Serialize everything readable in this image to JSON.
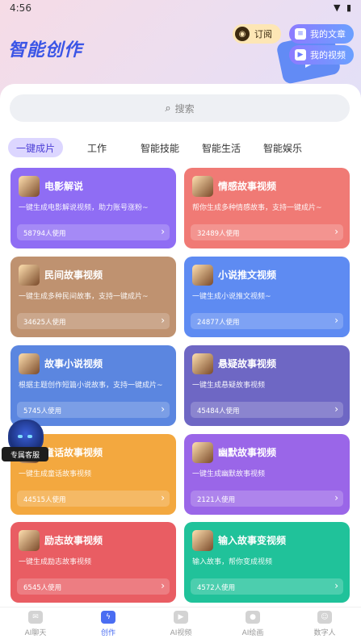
{
  "status": {
    "time": "4:56",
    "icons": "▼ ▮"
  },
  "header": {
    "brand": "智能创作",
    "subscribe_label": "订阅",
    "my_articles_label": "我的文章",
    "my_videos_label": "我的视频"
  },
  "search": {
    "placeholder": "搜索"
  },
  "tabs": [
    {
      "label": "一键成片",
      "active": true
    },
    {
      "label": "工作"
    },
    {
      "label": "智能技能"
    },
    {
      "label": "智能生活"
    },
    {
      "label": "智能娱乐"
    }
  ],
  "cards": [
    {
      "title": "电影解说",
      "desc": "一键生成电影解说视频，助力账号涨粉~",
      "users": "58794人使用",
      "color": "#8f6df4"
    },
    {
      "title": "情感故事视频",
      "desc": "帮你生成多种情感故事，支持一键成片~",
      "users": "32489人使用",
      "color": "#f07a75"
    },
    {
      "title": "民间故事视频",
      "desc": "一键生成多种民间故事，支持一键成片~",
      "users": "34625人使用",
      "color": "#bf9270"
    },
    {
      "title": "小说推文视频",
      "desc": "一键生成小说推文视频~",
      "users": "24877人使用",
      "color": "#5e8bf2"
    },
    {
      "title": "故事小说视频",
      "desc": "根据主题创作短篇小说故事，支持一键成片~",
      "users": "5745人使用",
      "color": "#5b86e0"
    },
    {
      "title": "悬疑故事视频",
      "desc": "一键生成悬疑故事视频",
      "users": "45484人使用",
      "color": "#6e67c4"
    },
    {
      "title": "童话故事视频",
      "desc": "一键生成童话故事视频",
      "users": "44515人使用",
      "color": "#f3a83f"
    },
    {
      "title": "幽默故事视频",
      "desc": "一键生成幽默故事视频",
      "users": "2121人使用",
      "color": "#9a66e8"
    },
    {
      "title": "励志故事视频",
      "desc": "一键生成励志故事视频",
      "users": "6545人使用",
      "color": "#e95d63"
    },
    {
      "title": "输入故事变视频",
      "desc": "输入故事，帮你变成视频",
      "users": "4572人使用",
      "color": "#20c29a"
    }
  ],
  "service": {
    "label": "专属客服"
  },
  "nav": [
    {
      "label": "AI聊天",
      "icon": "chat-icon"
    },
    {
      "label": "创作",
      "icon": "create-icon",
      "active": true
    },
    {
      "label": "AI视频",
      "icon": "video-icon"
    },
    {
      "label": "AI绘画",
      "icon": "palette-icon"
    },
    {
      "label": "数字人",
      "icon": "robot-icon"
    }
  ]
}
